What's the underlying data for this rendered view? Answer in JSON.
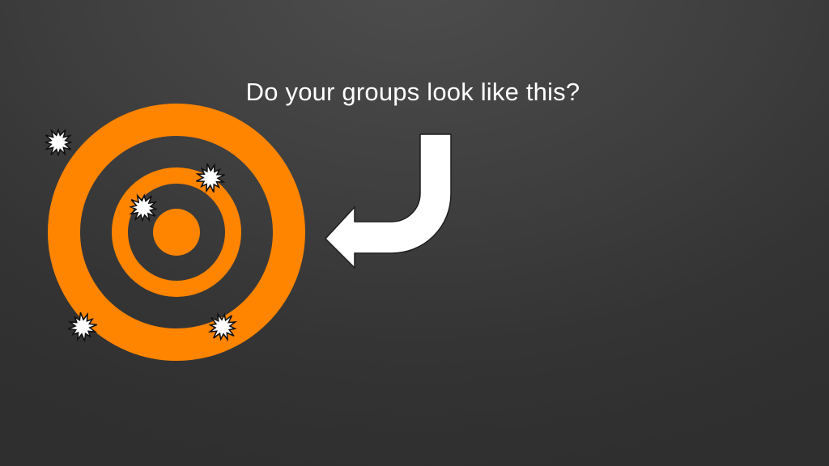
{
  "slide": {
    "title": "Do your groups look like this?"
  },
  "target": {
    "ring_color": "#ff8400",
    "background_color": "#3b3b3b"
  },
  "marks": {
    "count": 5,
    "color": "#ffffff",
    "outline_color": "#111111"
  },
  "arrow": {
    "color": "#ffffff",
    "outline_color": "#1e1e1e"
  }
}
